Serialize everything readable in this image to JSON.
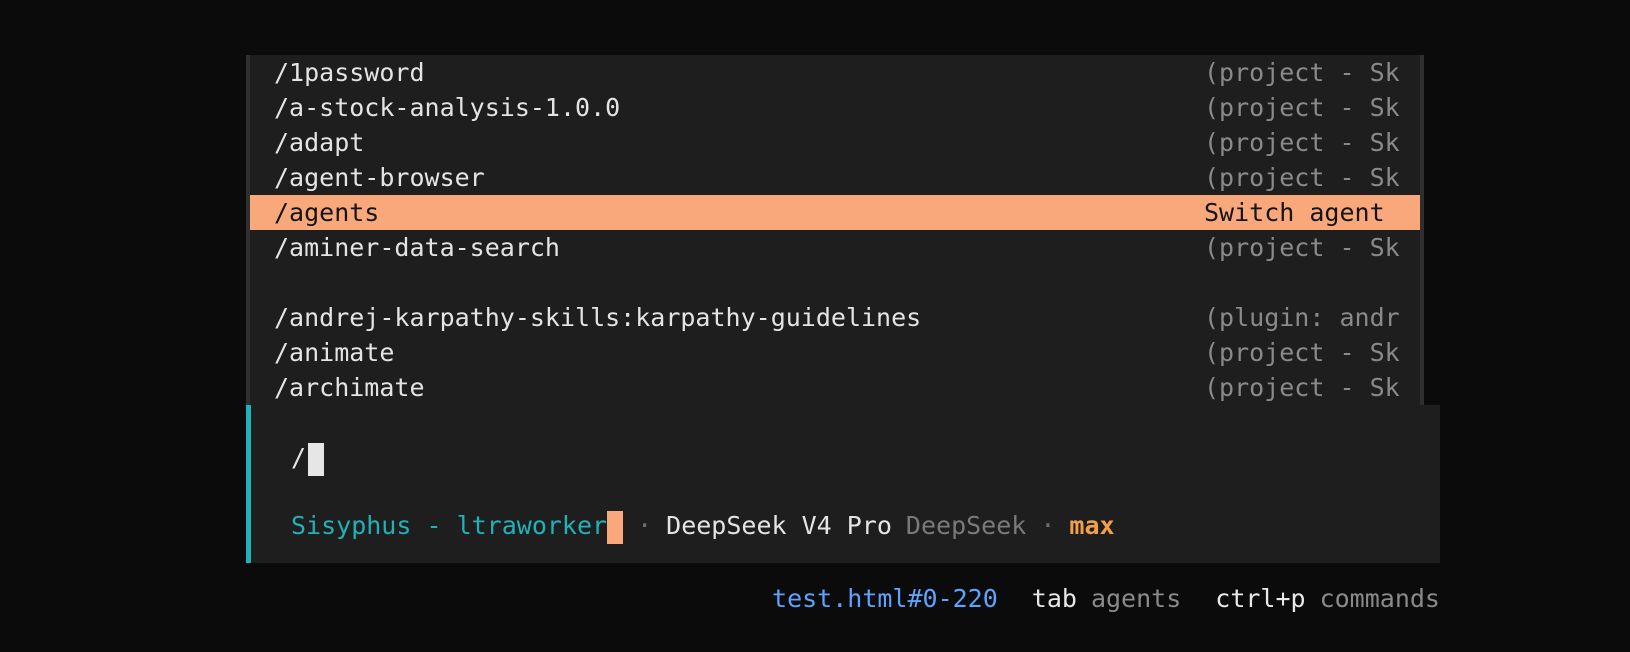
{
  "commands": [
    {
      "name": "/1password",
      "desc": "(project - Sk",
      "selected": false
    },
    {
      "name": "/a-stock-analysis-1.0.0",
      "desc": "(project - Sk",
      "selected": false
    },
    {
      "name": "/adapt",
      "desc": "(project - Sk",
      "selected": false
    },
    {
      "name": "/agent-browser",
      "desc": "(project - Sk",
      "selected": false
    },
    {
      "name": "/agents",
      "desc": "Switch agent",
      "selected": true
    },
    {
      "name": "/aminer-data-search",
      "desc": "(project - Sk",
      "selected": false
    },
    {
      "name": "",
      "desc": "",
      "selected": false
    },
    {
      "name": "/andrej-karpathy-skills:karpathy-guidelines",
      "desc": "(plugin: andr",
      "selected": false
    },
    {
      "name": "/animate",
      "desc": "(project - Sk",
      "selected": false
    },
    {
      "name": "/archimate",
      "desc": "(project - Sk",
      "selected": false
    }
  ],
  "input": {
    "value": "/"
  },
  "status": {
    "agent": "Sisyphus - ltraworker",
    "separator": "·",
    "model": "DeepSeek V4 Pro",
    "provider": "DeepSeek",
    "effort": "max"
  },
  "hints": {
    "link": "test.html#0-220",
    "tab_key": "tab",
    "tab_label": "agents",
    "cmd_key": "ctrl+p",
    "cmd_label": "commands"
  },
  "colors": {
    "accent": "#1fb2b8",
    "selection": "#f8a87a",
    "effort": "#f0a04a",
    "link": "#5ea3ff"
  }
}
